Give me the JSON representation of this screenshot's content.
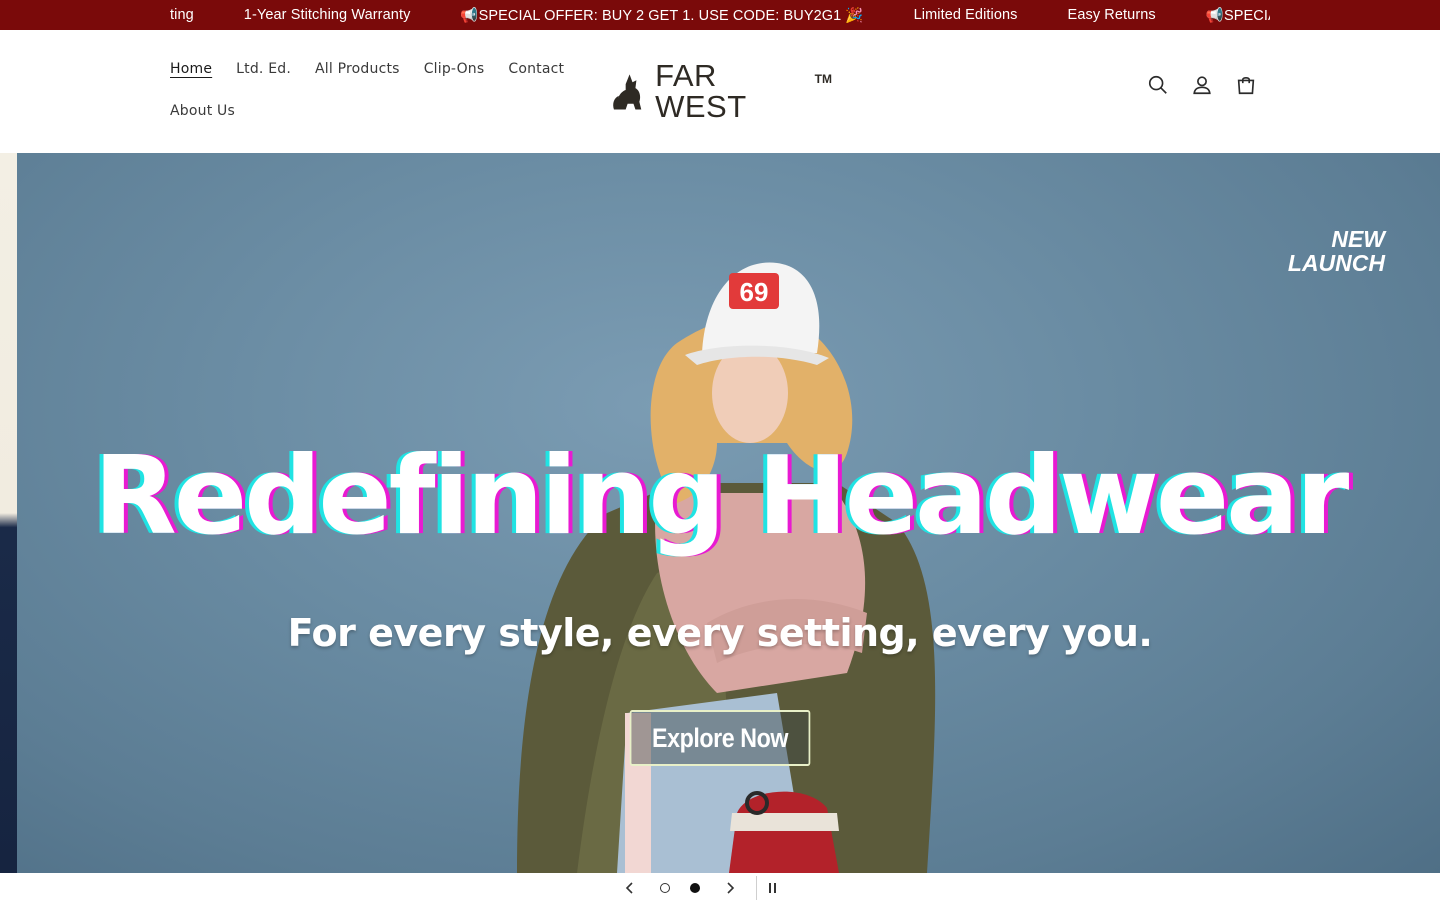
{
  "announcement": {
    "items": [
      "ting",
      "1-Year Stitching Warranty",
      "📢SPECIAL OFFER: BUY 2 GET 1. USE CODE: BUY2G1 🎉",
      "Limited Editions",
      "Easy Returns",
      "📢SPECIAL OF"
    ]
  },
  "nav": {
    "row1": [
      "Home",
      "Ltd. Ed.",
      "All Products",
      "Clip-Ons",
      "Contact"
    ],
    "row2": [
      "About Us"
    ]
  },
  "logo": {
    "text": "FAR WEST",
    "tm": "TM"
  },
  "header_icons": [
    "search-icon",
    "account-icon",
    "cart-icon"
  ],
  "hero": {
    "badge_line1": "NEW",
    "badge_line2": "LAUNCH",
    "title": "Redefining Headwear",
    "subtitle": "For every style, every setting, every you.",
    "cta": "Explore Now",
    "cap_text": "69"
  },
  "slider": {
    "prev_icon": "chevron-left-icon",
    "next_icon": "chevron-right-icon",
    "pause_icon": "pause-icon",
    "slide_count": 2,
    "active_slide": 2
  },
  "colors": {
    "announcement_bg": "#7a0a0a",
    "hero_bg": "#6a8ca3",
    "title_shadow_cyan": "#20e3e3",
    "title_shadow_magenta": "#e81ad2"
  }
}
